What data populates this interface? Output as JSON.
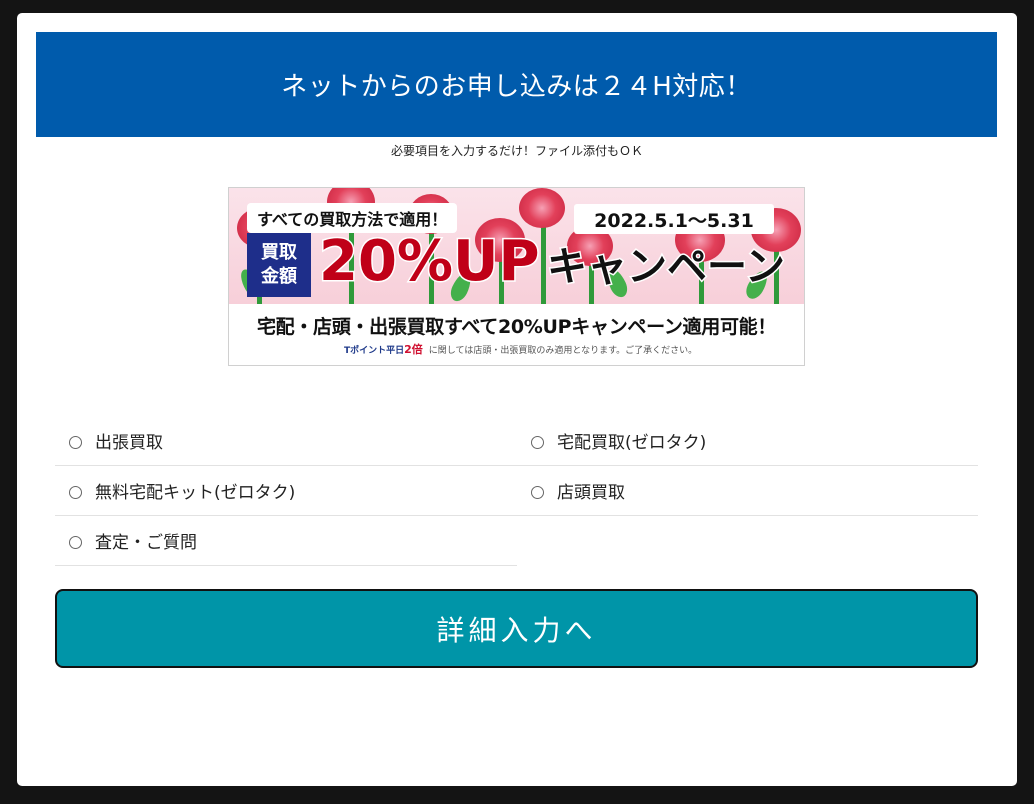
{
  "header": {
    "title": "ネットからのお申し込みは２４H対応！"
  },
  "subtitle": "必要項目を入力するだけ！ファイル添付もＯＫ",
  "banner": {
    "tagline": "すべての買取方法で適用！",
    "date": "2022.5.1〜5.31",
    "box_line1": "買取",
    "box_line2": "金額",
    "percent": "20%UP",
    "campaign": "キャンペーン",
    "bottom_line": "宅配・店頭・出張買取すべて20%UPキャンペーン適用可能！",
    "tpoint_label": "Tポイント平日",
    "tpoint_multiplier": "2倍",
    "note": "に関しては店頭・出張買取のみ適用となります。ご了承ください。"
  },
  "options": [
    {
      "label": "出張買取"
    },
    {
      "label": "宅配買取(ゼロタク)"
    },
    {
      "label": "無料宅配キット(ゼロタク)"
    },
    {
      "label": "店頭買取"
    },
    {
      "label": "査定・ご質問"
    }
  ],
  "next_button": {
    "label": "詳細入力へ"
  },
  "colors": {
    "header_bg": "#005bac",
    "button_bg": "#0095a8",
    "overlay": "#141414"
  }
}
